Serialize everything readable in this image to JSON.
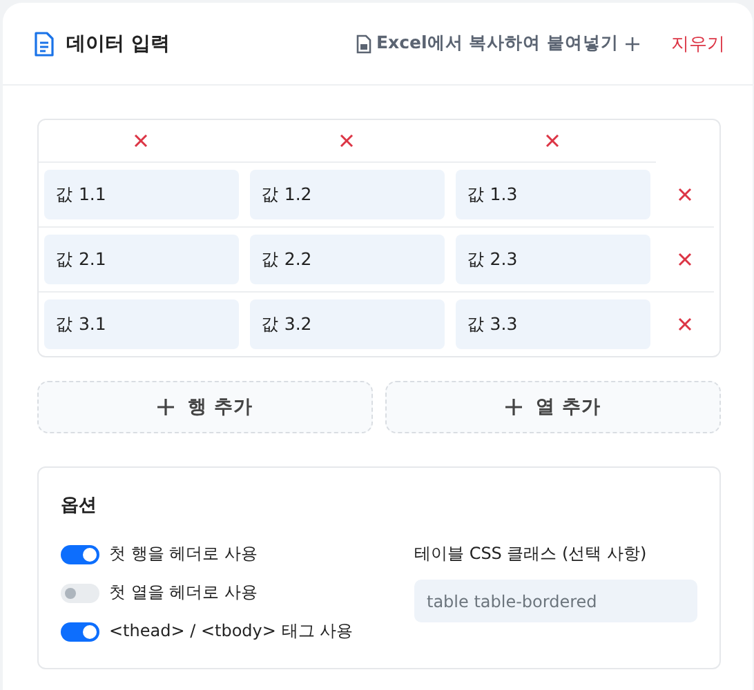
{
  "header": {
    "title": "데이터 입력",
    "paste_button": "Excel에서 복사하여 붙여넣기",
    "clear_button": "지우기"
  },
  "table": {
    "rows": [
      [
        "값 1.1",
        "값 1.2",
        "값 1.3"
      ],
      [
        "값 2.1",
        "값 2.2",
        "값 2.3"
      ],
      [
        "값 3.1",
        "값 3.2",
        "값 3.3"
      ]
    ]
  },
  "add_row_button": "행 추가",
  "add_column_button": "열 추가",
  "options": {
    "title": "옵션",
    "toggles": [
      {
        "label": "첫 행을 헤더로 사용",
        "on": true
      },
      {
        "label": "첫 열을 헤더로 사용",
        "on": false
      },
      {
        "label": "<thead> / <tbody> 태그 사용",
        "on": true
      }
    ],
    "class_field": {
      "label": "테이블 CSS 클래스 (선택 사항)",
      "placeholder": "table table-bordered"
    }
  }
}
